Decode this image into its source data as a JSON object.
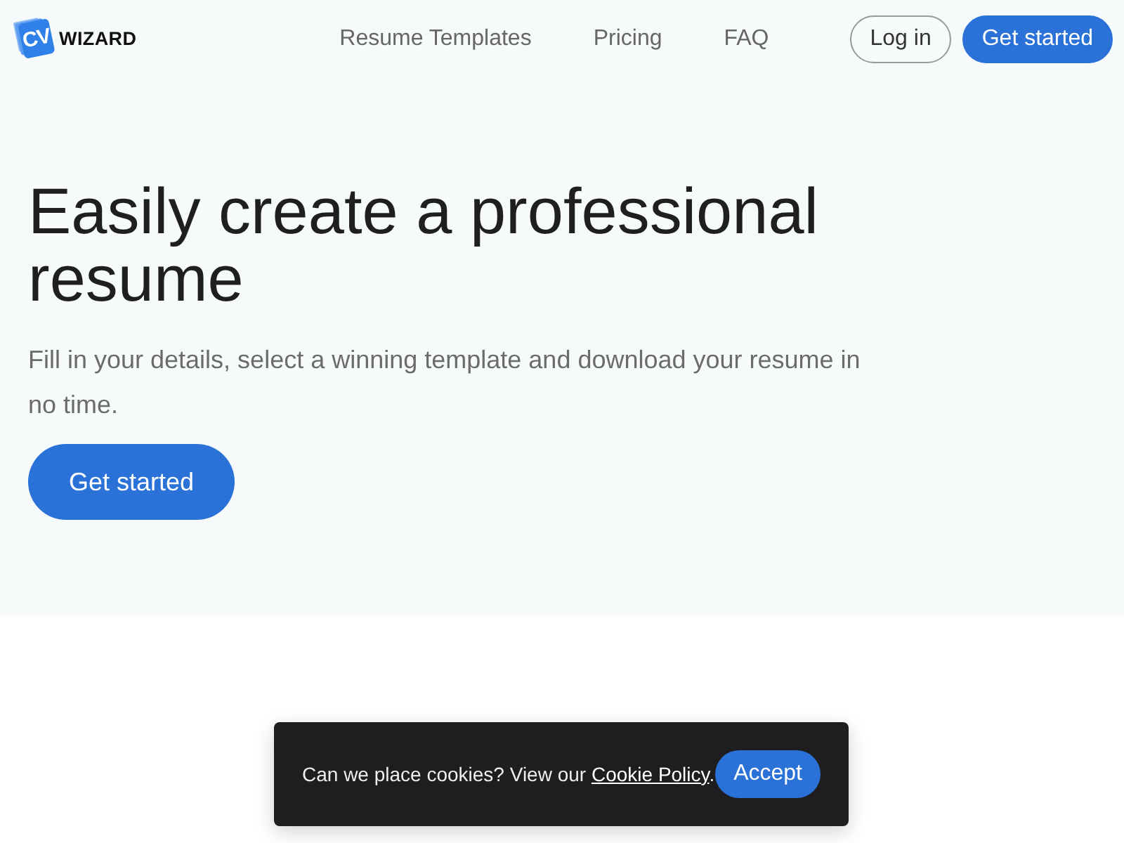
{
  "header": {
    "logo": {
      "mark": "CV",
      "wordmark": "WIZARD"
    },
    "nav": [
      {
        "label": "Resume Templates"
      },
      {
        "label": "Pricing"
      },
      {
        "label": "FAQ"
      }
    ],
    "actions": [
      {
        "label": "Log in",
        "kind": "outline"
      },
      {
        "label": "Get started",
        "kind": "primary"
      }
    ]
  },
  "hero": {
    "title": "Easily create a professional resume",
    "subtitle": "Fill in your details, select a winning template and download your resume in no time.",
    "button": "Get started"
  },
  "cookie_banner": {
    "text_before": "Can we place cookies? View our ",
    "link": "Cookie Policy",
    "text_after": ".",
    "button": "Accept"
  }
}
